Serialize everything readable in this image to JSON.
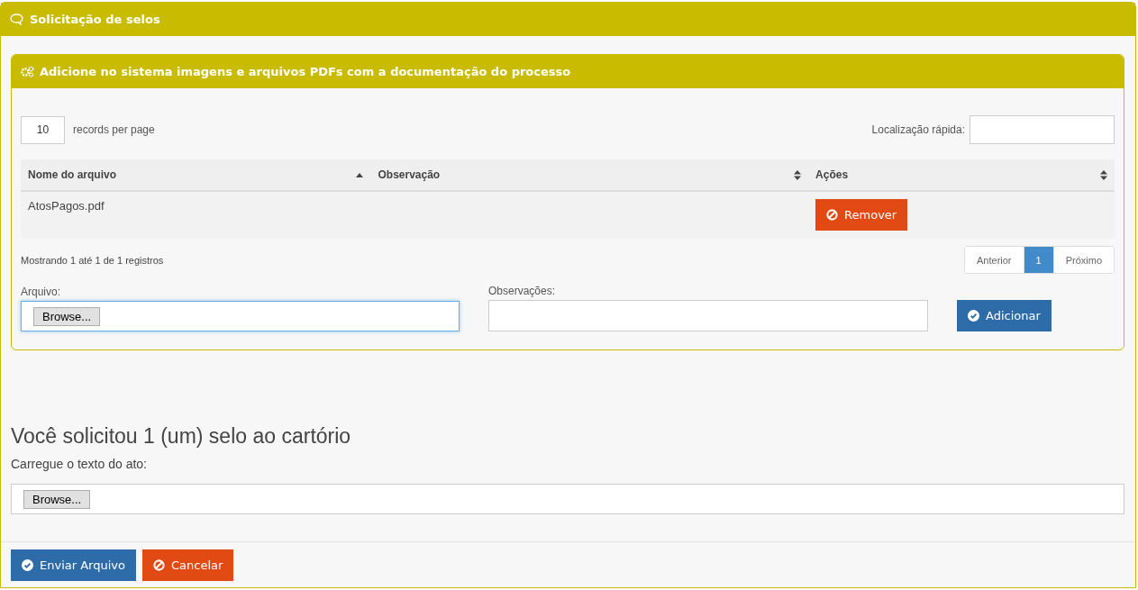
{
  "panel": {
    "title": "Solicitação de selos"
  },
  "upload_panel": {
    "title": "Adicione no sistema imagens e arquivos PDFs com a documentação do processo",
    "page_size": {
      "value": "10",
      "label": "records per page"
    },
    "search": {
      "label": "Localização rápida:"
    },
    "table": {
      "columns": [
        {
          "label": "Nome do arquivo",
          "sorted": true
        },
        {
          "label": "Observação",
          "sorted": false
        },
        {
          "label": "Ações",
          "sorted": false
        }
      ],
      "rows": [
        {
          "file": "AtosPagos.pdf",
          "action": "Remover"
        }
      ]
    },
    "info": "Mostrando 1 até 1 de 1 registros",
    "pagination": [
      {
        "label": "Anterior",
        "selected": false
      },
      {
        "label": "1",
        "selected": true
      },
      {
        "label": "Próximo",
        "selected": false
      }
    ],
    "file_field": {
      "label": "Arquivo:",
      "button": "Browse...",
      "focused": true
    },
    "notes_field": {
      "label": "Observações:"
    },
    "add_button": "Adicionar"
  },
  "heading": "Você solicitou 1 (um) selo ao cartório",
  "act_upload": {
    "label": "Carregue o texto do ato:",
    "button": "Browse..."
  },
  "footer": {
    "buttons": [
      {
        "label": "Enviar Arquivo",
        "kind": "primary"
      },
      {
        "label": "Cancelar",
        "kind": "danger"
      }
    ]
  }
}
